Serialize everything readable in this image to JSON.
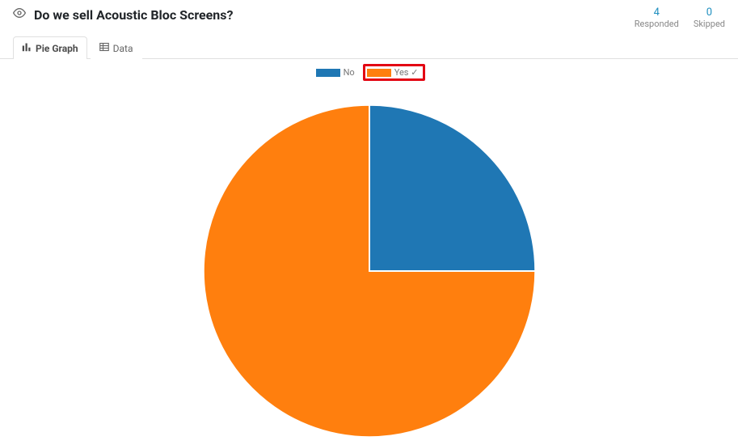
{
  "header": {
    "question": "Do we sell Acoustic Bloc Screens?",
    "responded_count": "4",
    "responded_label": "Responded",
    "skipped_count": "0",
    "skipped_label": "Skipped"
  },
  "tabs": {
    "pie_label": "Pie Graph",
    "data_label": "Data"
  },
  "legend": {
    "no_label": "No",
    "yes_label": "Yes ✓"
  },
  "colors": {
    "no": "#1f77b4",
    "yes": "#ff7f0e",
    "highlight": "#e30613"
  },
  "chart_data": {
    "type": "pie",
    "title": "Do we sell Acoustic Bloc Screens?",
    "series": [
      {
        "name": "No",
        "value": 1,
        "label": "No",
        "percent": 25
      },
      {
        "name": "Yes",
        "value": 3,
        "label": "Yes ✓",
        "percent": 75
      }
    ],
    "total_responses": 4,
    "legend_position": "top"
  }
}
